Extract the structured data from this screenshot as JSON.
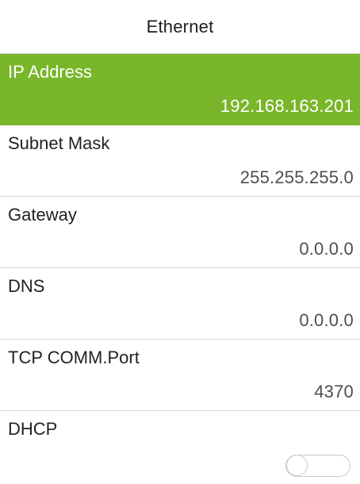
{
  "header": {
    "title": "Ethernet"
  },
  "items": [
    {
      "label": "IP Address",
      "value": "192.168.163.201"
    },
    {
      "label": "Subnet Mask",
      "value": "255.255.255.0"
    },
    {
      "label": "Gateway",
      "value": "0.0.0.0"
    },
    {
      "label": "DNS",
      "value": "0.0.0.0"
    },
    {
      "label": "TCP COMM.Port",
      "value": "4370"
    },
    {
      "label": "DHCP",
      "toggle_on": false
    }
  ],
  "colors": {
    "selected_background": "#79b62a",
    "divider": "#d5d5d5",
    "toggle_outline": "#c8c8c8"
  }
}
